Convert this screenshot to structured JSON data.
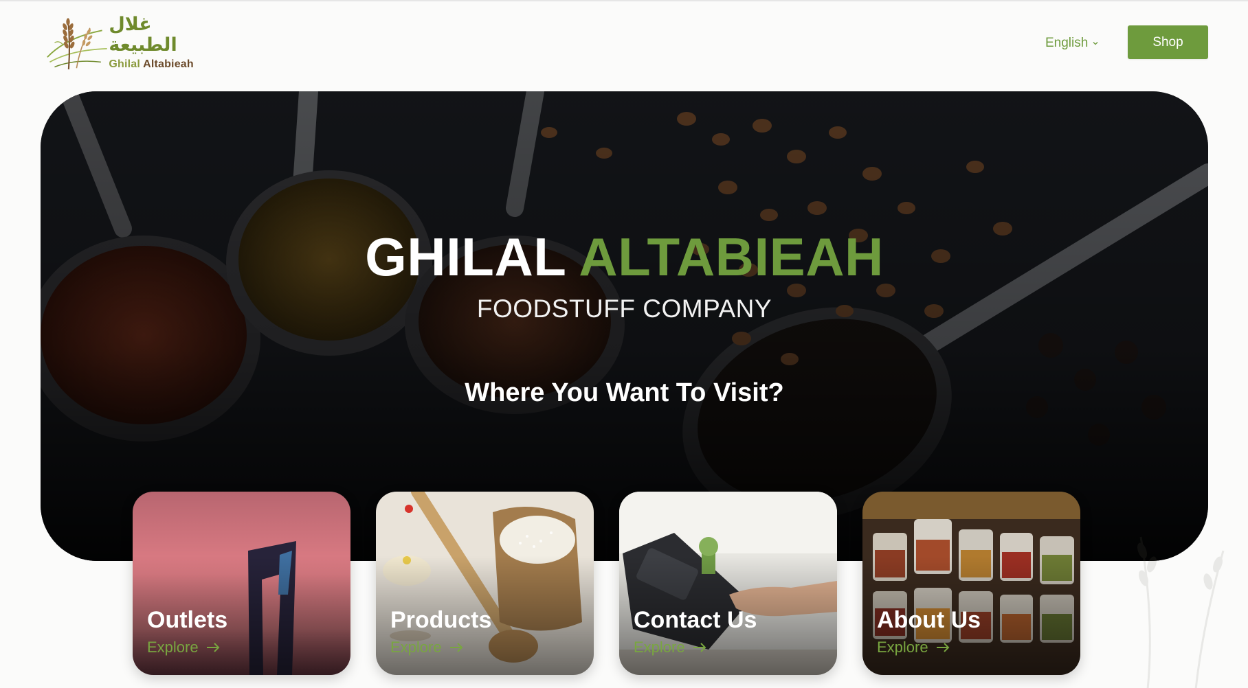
{
  "header": {
    "logo": {
      "arabic": "غلال الطبيعة",
      "latin_part1": "Ghilal",
      "latin_part2": "Altabieah"
    },
    "language": "English",
    "shop_label": "Shop"
  },
  "hero": {
    "title_white": "GHILAL",
    "title_green": "ALTABIEAH",
    "subtitle": "FOODSTUFF COMPANY",
    "question": "Where You Want To Visit?"
  },
  "cards": [
    {
      "title": "Outlets",
      "link": "Explore"
    },
    {
      "title": "Products",
      "link": "Explore"
    },
    {
      "title": "Contact Us",
      "link": "Explore"
    },
    {
      "title": "About Us",
      "link": "Explore"
    }
  ],
  "colors": {
    "brand_green": "#6e9b3d",
    "brand_brown": "#6b4a2a",
    "page_bg": "#fbfbfa"
  },
  "icons": {
    "chevron": "chevron-down-icon",
    "arrow": "arrow-right-icon",
    "logo": "wheat-logo-icon"
  }
}
